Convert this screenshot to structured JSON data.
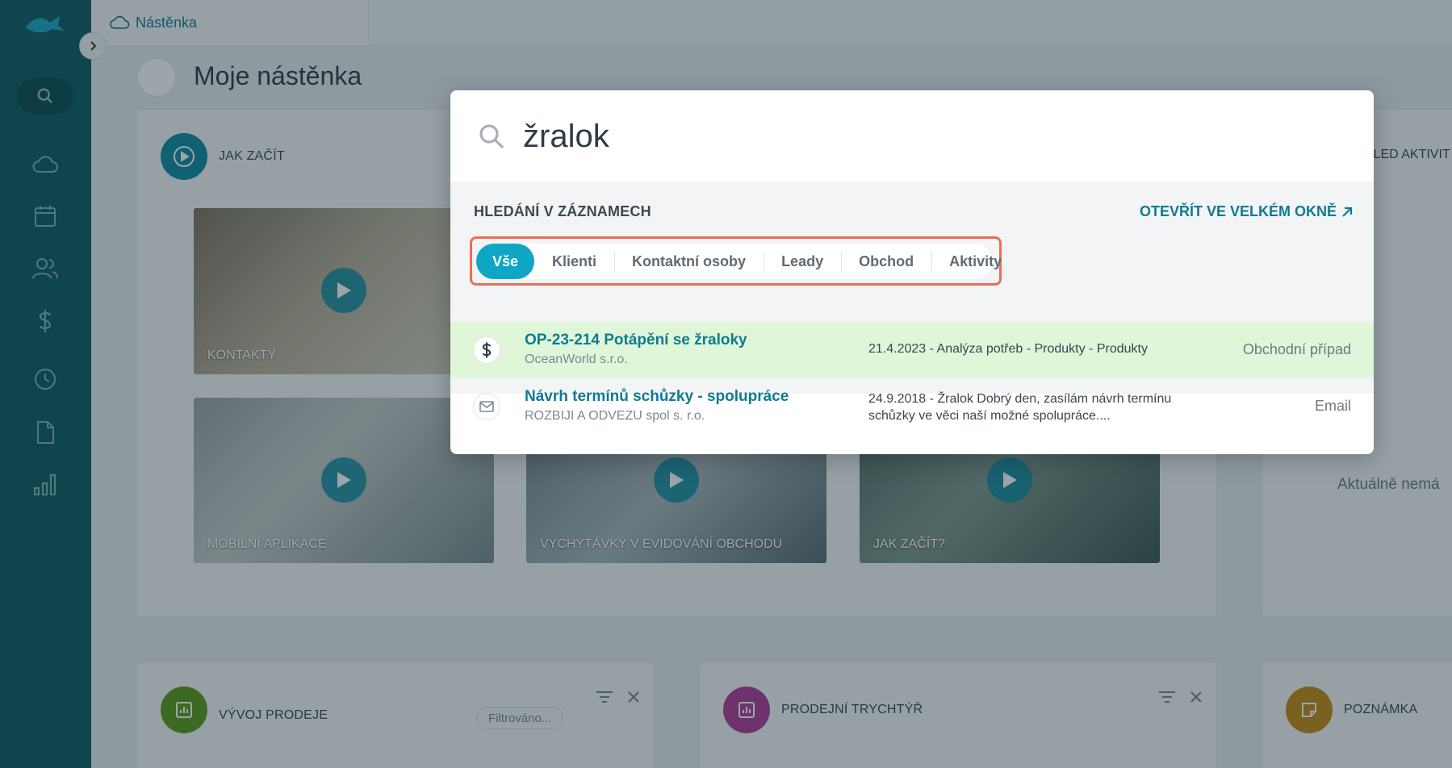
{
  "topbar": {
    "tab_label": "Nástěnka"
  },
  "page": {
    "title": "Moje nástěnka"
  },
  "widgets": {
    "jak_zacit": {
      "title": "JAK ZAČÍT",
      "videos": [
        {
          "label": "KONTAKTY"
        },
        {
          "label": "MOBILNÍ APLIKACE"
        },
        {
          "label": "VYCHYTÁVKY V EVIDOVÁNÍ OBCHODU"
        },
        {
          "label": "JAK ZAČÍT?"
        }
      ]
    },
    "right_panel": {
      "title_fragment": "HLED AKTIVIT",
      "empty_text": "Aktuálně nemá"
    },
    "vyvoj_prodeje": {
      "title": "VÝVOJ PRODEJE",
      "filter_label": "Filtrováno..."
    },
    "prodejni_trychtyr": {
      "title": "PRODEJNÍ TRYCHTÝŘ"
    },
    "poznamka": {
      "title": "POZNÁMKA"
    }
  },
  "search_modal": {
    "query": "žralok",
    "section_title": "HLEDÁNÍ V ZÁZNAMECH",
    "open_link": "OTEVŘÍT VE VELKÉM OKNĚ",
    "tabs": [
      "Vše",
      "Klienti",
      "Kontaktní osoby",
      "Leady",
      "Obchod",
      "Aktivity"
    ],
    "active_tab": "Vše",
    "results": [
      {
        "title": "OP-23-214 Potápění se žraloky",
        "subtitle": "OceanWorld s.r.o.",
        "description": "21.4.2023 - Analýza potřeb - Produkty - Produkty",
        "type": "Obchodní případ",
        "icon": "dollar-icon"
      },
      {
        "title": "Návrh termínů schůzky - spolupráce",
        "subtitle": "ROZBIJI A ODVEZU spol s. r.o.",
        "description": "24.9.2018 - Žralok Dobrý den, zasílám návrh termínu schůzky ve věci naší možné spolupráce....",
        "type": "Email",
        "icon": "mail-icon"
      }
    ]
  },
  "colors": {
    "sidebar": "#0e5a63",
    "accent": "#0f7a92",
    "active_tab": "#0fa6c6",
    "highlight_row": "#dff7d8",
    "tabs_outline": "#ee6c58"
  }
}
